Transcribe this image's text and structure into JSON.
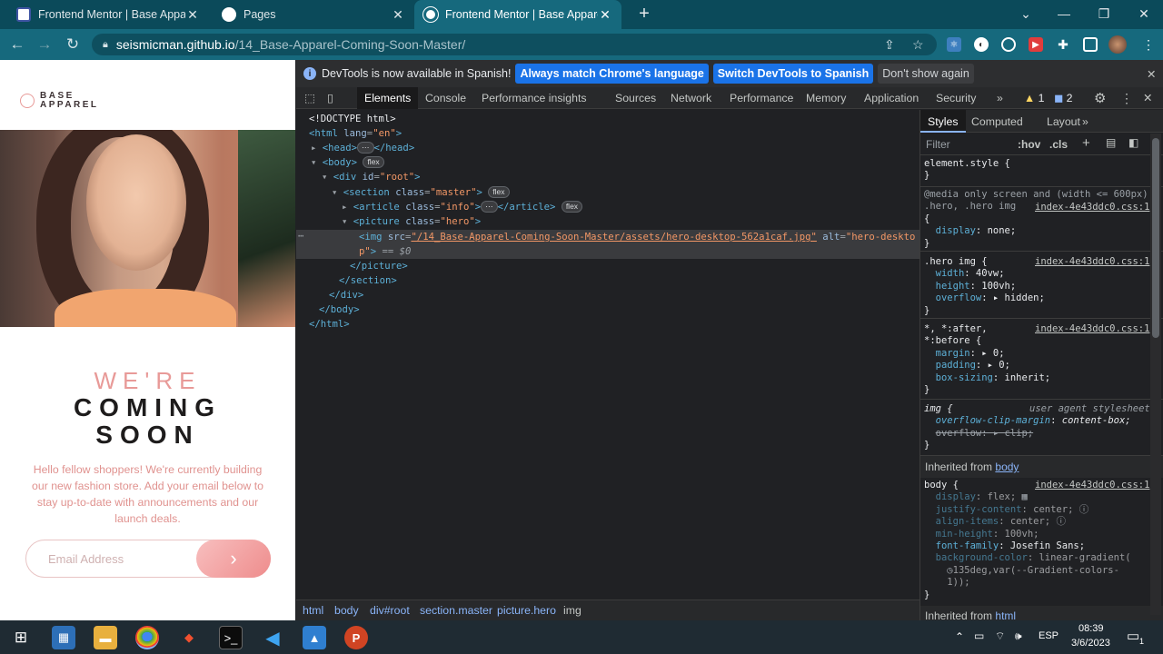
{
  "browser": {
    "tabs": [
      {
        "title": "Frontend Mentor | Base Apparel",
        "favicon": "frontend-mentor-icon",
        "active": false
      },
      {
        "title": "Pages",
        "favicon": "github-icon",
        "active": false
      },
      {
        "title": "Frontend Mentor | Base Apparel",
        "favicon": "frontend-mentor-icon",
        "active": true
      }
    ],
    "new_tab": "+",
    "address": {
      "host": "seismicman.github.io",
      "path": "/14_Base-Apparel-Coming-Soon-Master/"
    }
  },
  "page": {
    "logo": {
      "line1": "BASE",
      "line2": "APPAREL"
    },
    "headline_light": "WE'RE",
    "headline_bold_1": "COMING",
    "headline_bold_2": "SOON",
    "description": "Hello fellow shoppers! We're currently building our new fashion store. Add your email below to stay up-to-date with announcements and our launch deals.",
    "email_placeholder": "Email Address",
    "submit_glyph": "›"
  },
  "devtools": {
    "infobar": {
      "message": "DevTools is now available in Spanish!",
      "btn_match": "Always match Chrome's language",
      "btn_switch": "Switch DevTools to Spanish",
      "btn_dismiss": "Don't show again"
    },
    "tabs": [
      "Elements",
      "Console",
      "Performance insights",
      "Sources",
      "Network",
      "Performance",
      "Memory",
      "Application",
      "Security"
    ],
    "more": "»",
    "warnings": "1",
    "messages": "2",
    "dom": {
      "doctype": "<!DOCTYPE html>",
      "html_open": "<html",
      "lang_attr": "lang",
      "lang_val": "\"en\"",
      "head": "<head>",
      "head_close": "</head>",
      "body": "<body>",
      "div_open": "<div",
      "id_attr": "id",
      "id_val": "\"root\"",
      "section_open": "<section",
      "class_attr": "class",
      "section_class": "\"master\"",
      "article_open": "<article",
      "article_class": "\"info\"",
      "article_close": "</article>",
      "picture_open": "<picture",
      "picture_class": "\"hero\"",
      "img_open": "<img",
      "src_attr": "src",
      "src_val": "\"/14_Base-Apparel-Coming-Soon-Master/assets/hero-desktop-562a1caf.jpg\"",
      "alt_attr": "alt",
      "alt_val_1": "\"hero-deskto",
      "alt_val_2": "p\"",
      "selected_marker": "== $0",
      "picture_close": "</picture>",
      "section_close": "</section>",
      "div_close": "</div>",
      "body_close": "</body>",
      "html_close": "</html>",
      "flex": "flex",
      "ellipsis": "⋯",
      "gt": ">"
    },
    "breadcrumbs": [
      "html",
      "body",
      "div#root",
      "section.master",
      "picture.hero",
      "img"
    ],
    "styles": {
      "tabs": [
        "Styles",
        "Computed",
        "Layout"
      ],
      "filter_placeholder": "Filter",
      "hov": ":hov",
      "cls": ".cls",
      "element_style": "element.style {",
      "close_brace": "}",
      "media": "@media only screen and (width <= 600px)",
      "rule1_sel": ".hero, .hero img",
      "rule1_src": "index-4e43ddc0.css:1",
      "open_brace": "{",
      "rule1_p1": "display",
      "rule1_v1": "none;",
      "rule2_sel": ".hero img {",
      "rule2_src": "index-4e43ddc0.css:1",
      "rule2_p1": "width",
      "rule2_v1": "40vw;",
      "rule2_p2": "height",
      "rule2_v2": "100vh;",
      "rule2_p3": "overflow",
      "rule2_v3": "hidden;",
      "rule3_sel1": "*, *:after,",
      "rule3_sel2": "*:before {",
      "rule3_src": "index-4e43ddc0.css:1",
      "rule3_p1": "margin",
      "rule3_v1": "0;",
      "rule3_p2": "padding",
      "rule3_v2": "0;",
      "rule3_p3": "box-sizing",
      "rule3_v3": "inherit;",
      "rule4_sel": "img {",
      "rule4_src": "user agent stylesheet",
      "rule4_p1": "overflow-clip-margin",
      "rule4_v1": "content-box;",
      "rule4_p2": "overflow",
      "rule4_v2": "clip;",
      "inherited_label": "Inherited from",
      "inherited_body": "body",
      "rule5_sel": "body {",
      "rule5_src": "index-4e43ddc0.css:1",
      "rule5_p1": "display",
      "rule5_v1": "flex;",
      "rule5_p2": "justify-content",
      "rule5_v2": "center;",
      "rule5_p3": "align-items",
      "rule5_v3": "center;",
      "rule5_p4": "min-height",
      "rule5_v4": "100vh;",
      "rule5_p5": "font-family",
      "rule5_v5": "Josefin Sans;",
      "rule5_p6": "background-color",
      "rule5_v6": "linear-gradient(",
      "rule5_v6b": "135deg,var(--Gradient-colors-",
      "rule5_v6c": "1));",
      "inherited_html": "html"
    }
  },
  "taskbar": {
    "lang": "ESP",
    "time": "08:39",
    "date": "3/6/2023",
    "notifications": "1"
  },
  "colors": {
    "accent": "#16697d",
    "brand_pink": "#e89a98"
  }
}
